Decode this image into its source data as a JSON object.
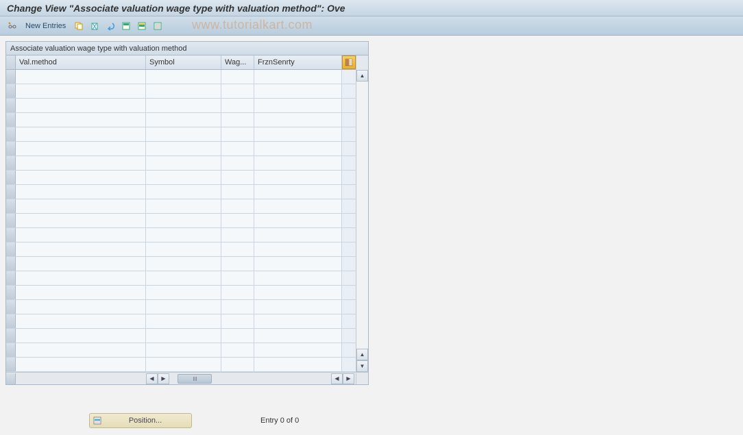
{
  "header": {
    "title": "Change View \"Associate valuation wage type with valuation method\": Ove"
  },
  "toolbar": {
    "new_entries": "New Entries",
    "icons": {
      "edit": "edit-icon",
      "copy": "copy-icon",
      "delete": "delete-icon",
      "undo": "undo-icon",
      "select_all": "select-all-icon",
      "select_block": "select-block-icon",
      "deselect": "deselect-icon"
    }
  },
  "watermark": "www.tutorialkart.com",
  "table": {
    "caption": "Associate valuation wage type with valuation method",
    "columns": {
      "valmethod": "Val.method",
      "symbol": "Symbol",
      "wag": "Wag...",
      "frzn": "FrznSenrty"
    },
    "rows": [
      {
        "valmethod": "",
        "symbol": "",
        "wag": "",
        "frzn": ""
      },
      {
        "valmethod": "",
        "symbol": "",
        "wag": "",
        "frzn": ""
      },
      {
        "valmethod": "",
        "symbol": "",
        "wag": "",
        "frzn": ""
      },
      {
        "valmethod": "",
        "symbol": "",
        "wag": "",
        "frzn": ""
      },
      {
        "valmethod": "",
        "symbol": "",
        "wag": "",
        "frzn": ""
      },
      {
        "valmethod": "",
        "symbol": "",
        "wag": "",
        "frzn": ""
      },
      {
        "valmethod": "",
        "symbol": "",
        "wag": "",
        "frzn": ""
      },
      {
        "valmethod": "",
        "symbol": "",
        "wag": "",
        "frzn": ""
      },
      {
        "valmethod": "",
        "symbol": "",
        "wag": "",
        "frzn": ""
      },
      {
        "valmethod": "",
        "symbol": "",
        "wag": "",
        "frzn": ""
      },
      {
        "valmethod": "",
        "symbol": "",
        "wag": "",
        "frzn": ""
      },
      {
        "valmethod": "",
        "symbol": "",
        "wag": "",
        "frzn": ""
      },
      {
        "valmethod": "",
        "symbol": "",
        "wag": "",
        "frzn": ""
      },
      {
        "valmethod": "",
        "symbol": "",
        "wag": "",
        "frzn": ""
      },
      {
        "valmethod": "",
        "symbol": "",
        "wag": "",
        "frzn": ""
      },
      {
        "valmethod": "",
        "symbol": "",
        "wag": "",
        "frzn": ""
      },
      {
        "valmethod": "",
        "symbol": "",
        "wag": "",
        "frzn": ""
      },
      {
        "valmethod": "",
        "symbol": "",
        "wag": "",
        "frzn": ""
      },
      {
        "valmethod": "",
        "symbol": "",
        "wag": "",
        "frzn": ""
      },
      {
        "valmethod": "",
        "symbol": "",
        "wag": "",
        "frzn": ""
      },
      {
        "valmethod": "",
        "symbol": "",
        "wag": "",
        "frzn": ""
      }
    ]
  },
  "footer": {
    "position_label": "Position...",
    "entry_text": "Entry 0 of 0"
  }
}
